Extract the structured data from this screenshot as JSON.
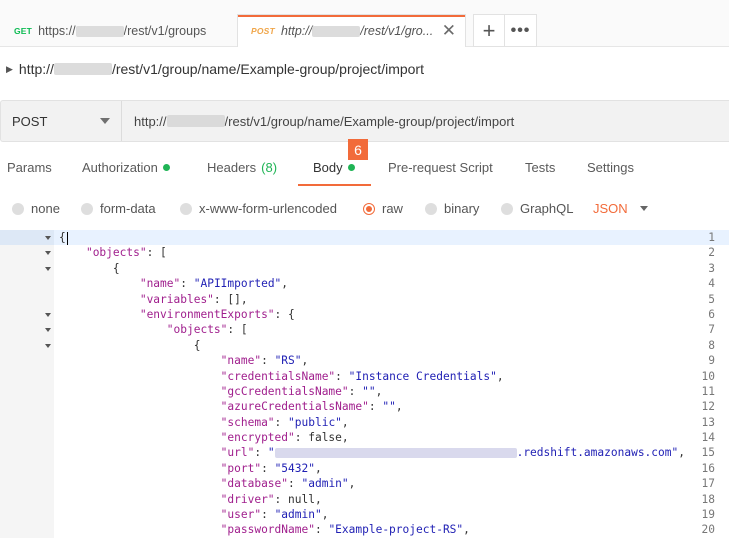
{
  "tabs": [
    {
      "method": "GET",
      "url_prefix": "https://",
      "url_suffix": "/rest/v1/groups"
    },
    {
      "method": "POST",
      "url_prefix": "http://",
      "url_suffix": "/rest/v1/gro..."
    }
  ],
  "tab_close_glyph": "✕",
  "tab_add_glyph": "+",
  "tab_more_glyph": "•••",
  "request": {
    "title_prefix": "http://",
    "title_suffix": "/rest/v1/group/name/Example-group/project/import",
    "method": "POST",
    "url_prefix": "http://",
    "url_suffix": "/rest/v1/group/name/Example-group/project/import"
  },
  "request_tabs": {
    "params": "Params",
    "authorization": "Authorization",
    "headers": "Headers",
    "headers_count": "(8)",
    "body": "Body",
    "prerequest": "Pre-request Script",
    "tests": "Tests",
    "settings": "Settings",
    "active": "Body"
  },
  "badge": "6",
  "body_options": {
    "none": "none",
    "form_data": "form-data",
    "urlencoded": "x-www-form-urlencoded",
    "raw": "raw",
    "binary": "binary",
    "graphql": "GraphQL",
    "selected": "raw",
    "format": "JSON"
  },
  "colors": {
    "accent": "#f26b3a",
    "green_status": "#1fb455",
    "json_key": "#a01f8d",
    "json_string": "#1f1fb4"
  },
  "editor": {
    "lines": [
      {
        "n": "1",
        "fold": true
      },
      {
        "n": "2",
        "fold": true
      },
      {
        "n": "3",
        "fold": true
      },
      {
        "n": "4",
        "fold": false
      },
      {
        "n": "5",
        "fold": false
      },
      {
        "n": "6",
        "fold": true
      },
      {
        "n": "7",
        "fold": true
      },
      {
        "n": "8",
        "fold": true
      },
      {
        "n": "9",
        "fold": false
      },
      {
        "n": "10",
        "fold": false
      },
      {
        "n": "11",
        "fold": false
      },
      {
        "n": "12",
        "fold": false
      },
      {
        "n": "13",
        "fold": false
      },
      {
        "n": "14",
        "fold": false
      },
      {
        "n": "15",
        "fold": false
      },
      {
        "n": "16",
        "fold": false
      },
      {
        "n": "17",
        "fold": false
      },
      {
        "n": "18",
        "fold": false
      },
      {
        "n": "19",
        "fold": false
      },
      {
        "n": "20",
        "fold": false
      }
    ],
    "code": {
      "l1_brace": "{",
      "l2_key": "\"objects\"",
      "l2_rest": ": [",
      "l3": "{",
      "l4_key": "\"name\"",
      "l4_val": "\"APIImported\"",
      "l5_key": "\"variables\"",
      "l5_rest": ": [],",
      "l6_key": "\"environmentExports\"",
      "l6_rest": ": {",
      "l7_key": "\"objects\"",
      "l7_rest": ": [",
      "l8": "{",
      "l9_key": "\"name\"",
      "l9_val": "\"RS\"",
      "l10_key": "\"credentialsName\"",
      "l10_val": "\"Instance Credentials\"",
      "l11_key": "\"gcCredentialsName\"",
      "l11_val": "\"\"",
      "l12_key": "\"azureCredentialsName\"",
      "l12_val": "\"\"",
      "l13_key": "\"schema\"",
      "l13_val": "\"public\"",
      "l14_key": "\"encrypted\"",
      "l14_rest": ": false,",
      "l15_key": "\"url\"",
      "l15_val_start": "\"",
      "l15_val_end": ".redshift.amazonaws.com\"",
      "l16_key": "\"port\"",
      "l16_val": "\"5432\"",
      "l17_key": "\"database\"",
      "l17_val": "\"admin\"",
      "l18_key": "\"driver\"",
      "l18_rest": ": null,",
      "l19_key": "\"user\"",
      "l19_val": "\"admin\"",
      "l20_key": "\"passwordName\"",
      "l20_val": "\"Example-project-RS\""
    }
  }
}
